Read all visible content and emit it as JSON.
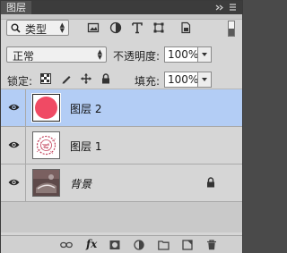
{
  "panel": {
    "tab_label": "图层"
  },
  "filter": {
    "kind_label": "类型",
    "icons": [
      "image-filter-icon",
      "adjustment-filter-icon",
      "type-filter-icon",
      "shape-filter-icon",
      "smart-object-filter-icon"
    ]
  },
  "blend": {
    "mode": "正常",
    "opacity_label": "不透明度:",
    "opacity_value": "100%"
  },
  "lock": {
    "label": "锁定:",
    "icons": [
      "lock-transparent-icon",
      "lock-image-icon",
      "lock-position-icon",
      "lock-all-icon"
    ],
    "fill_label": "填充:",
    "fill_value": "100%"
  },
  "layers": [
    {
      "name": "图层 2",
      "selected": true,
      "italic": false,
      "locked": false,
      "thumb": "pink-circle"
    },
    {
      "name": "图层 1",
      "selected": false,
      "italic": false,
      "locked": false,
      "thumb": "stamp"
    },
    {
      "name": "背景",
      "selected": false,
      "italic": true,
      "locked": true,
      "thumb": "photo"
    }
  ],
  "footer": {
    "icons": [
      "link-layers-icon",
      "fx-icon",
      "add-mask-icon",
      "adjustment-layer-icon",
      "new-group-icon",
      "new-layer-icon",
      "delete-layer-icon"
    ],
    "fx_label": "fx"
  },
  "colors": {
    "selection": "#b3cdf5",
    "pink_circle": "#f04a64",
    "panel_bg": "#d6d6d6"
  }
}
